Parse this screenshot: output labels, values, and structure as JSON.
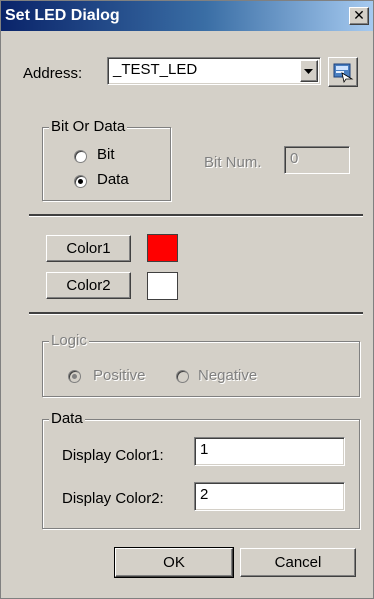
{
  "window": {
    "title": "Set LED Dialog",
    "close_glyph": "✕"
  },
  "address": {
    "label": "Address:",
    "value": "_TEST_LED",
    "dropdown_icon": "chevron-down-icon",
    "browse_icon": "tag-browse-icon"
  },
  "bit_or_data": {
    "legend": "Bit Or Data",
    "bit_label": "Bit",
    "data_label": "Data",
    "selected": "Data",
    "bit_num_label": "Bit Num.",
    "bit_num_value": "0"
  },
  "colors": {
    "color1_label": "Color1",
    "color1_value": "#ff0000",
    "color2_label": "Color2",
    "color2_value": "#ffffff"
  },
  "logic": {
    "legend": "Logic",
    "positive_label": "Positive",
    "negative_label": "Negative",
    "selected": "Positive"
  },
  "data": {
    "legend": "Data",
    "display_color1_label": "Display Color1:",
    "display_color1_value": "1",
    "display_color2_label": "Display Color2:",
    "display_color2_value": "2"
  },
  "buttons": {
    "ok_label": "OK",
    "cancel_label": "Cancel"
  }
}
